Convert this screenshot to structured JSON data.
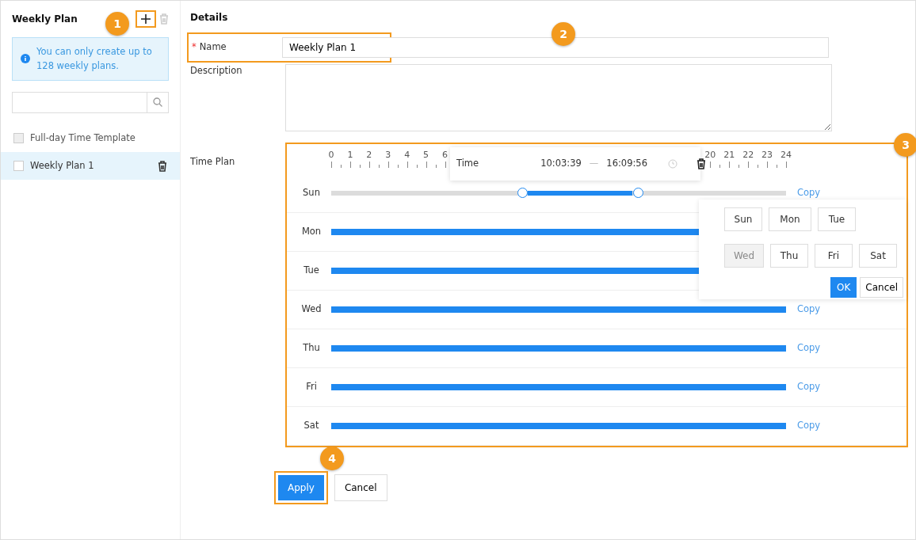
{
  "sidebar": {
    "title": "Weekly Plan",
    "callout": "1",
    "notice": "You can only create up to 128 weekly plans.",
    "items": [
      {
        "label": "Full-day Time Template",
        "checked": false,
        "disabled": true,
        "selected": false,
        "deletable": false
      },
      {
        "label": "Weekly Plan 1",
        "checked": false,
        "disabled": false,
        "selected": true,
        "deletable": true
      }
    ]
  },
  "details": {
    "title": "Details",
    "name": {
      "label": "Name",
      "required_mark": "*",
      "value": "Weekly Plan 1",
      "callout": "2"
    },
    "description": {
      "label": "Description"
    },
    "time_plan": {
      "label": "Time Plan",
      "callout": "3",
      "ruler_start": [
        "0",
        "1",
        "2",
        "3",
        "4",
        "5",
        "6"
      ],
      "ruler_end": [
        "20",
        "21",
        "22",
        "23",
        "24"
      ],
      "editor": {
        "label": "Time",
        "start": "10:03:39",
        "separator": "—",
        "end": "16:09:56"
      },
      "days": [
        {
          "label": "Sun",
          "kind": "editing",
          "copy": "Copy"
        },
        {
          "label": "Mon",
          "kind": "full"
        },
        {
          "label": "Tue",
          "kind": "full"
        },
        {
          "label": "Wed",
          "kind": "full",
          "copy": "Copy"
        },
        {
          "label": "Thu",
          "kind": "full",
          "copy": "Copy"
        },
        {
          "label": "Fri",
          "kind": "full",
          "copy": "Copy"
        },
        {
          "label": "Sat",
          "kind": "full",
          "copy": "Copy"
        }
      ],
      "copy_popup": {
        "days": [
          {
            "label": "Sun",
            "disabled": false
          },
          {
            "label": "Mon",
            "disabled": false
          },
          {
            "label": "Tue",
            "disabled": false
          },
          {
            "label": "Wed",
            "disabled": true
          },
          {
            "label": "Thu",
            "disabled": false
          },
          {
            "label": "Fri",
            "disabled": false
          },
          {
            "label": "Sat",
            "disabled": false
          }
        ],
        "ok": "OK",
        "cancel": "Cancel"
      }
    },
    "apply": "Apply",
    "cancel": "Cancel",
    "callout": "4"
  }
}
